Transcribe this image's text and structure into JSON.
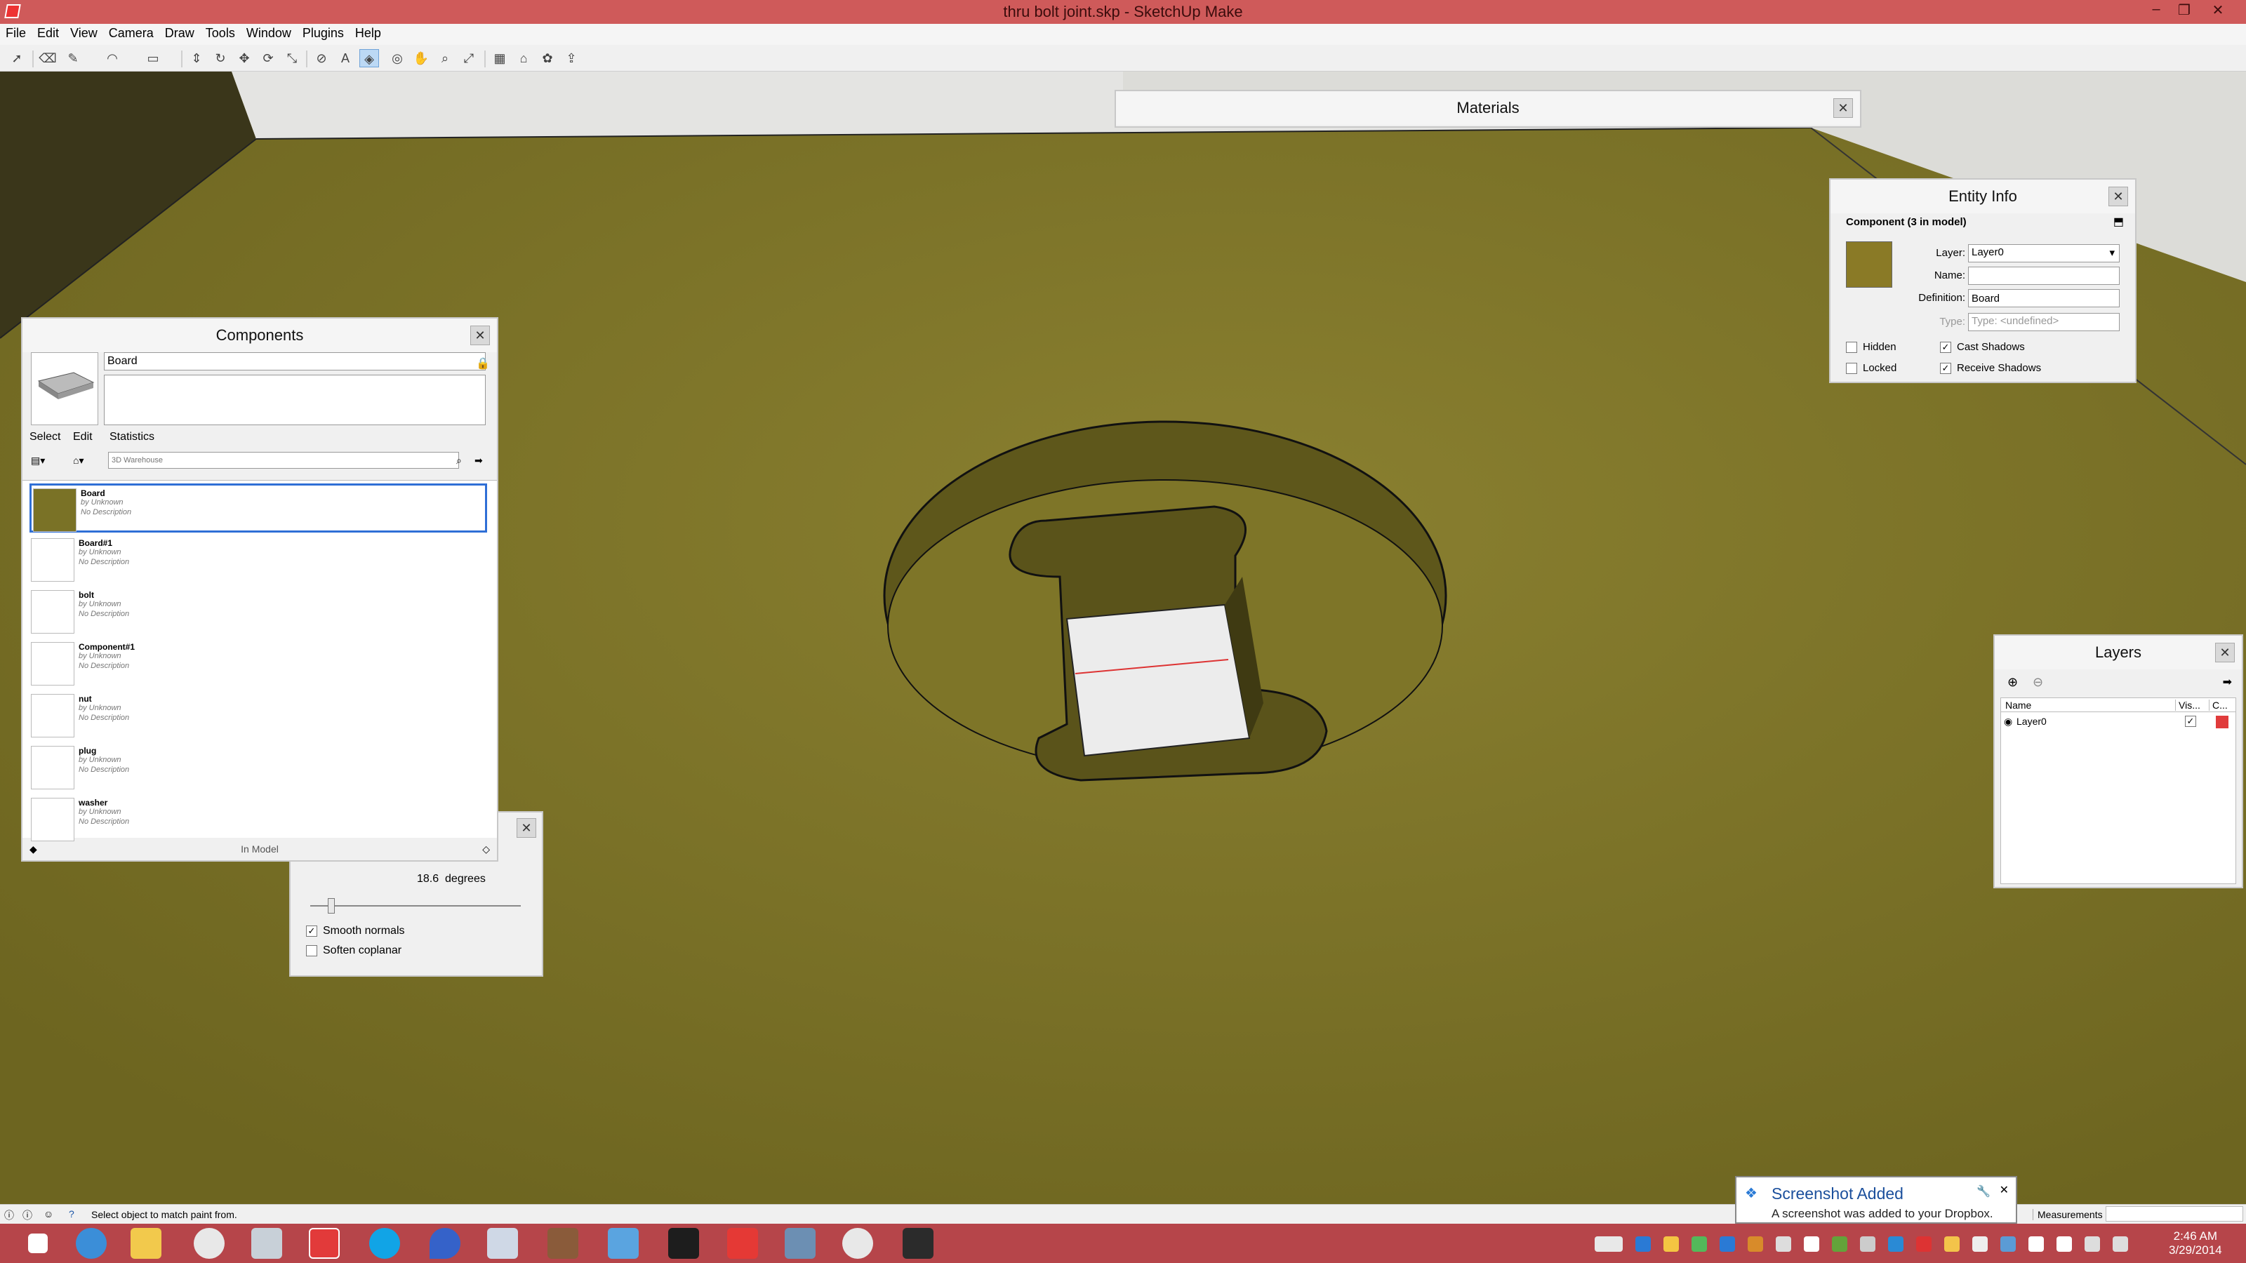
{
  "window": {
    "title": "thru bolt joint.skp - SketchUp Make",
    "minimize": "–",
    "maximize": "❐",
    "close": "✕"
  },
  "menu": [
    "File",
    "Edit",
    "View",
    "Camera",
    "Draw",
    "Tools",
    "Window",
    "Plugins",
    "Help"
  ],
  "toolbar": {
    "tools": [
      "select",
      "eraser",
      "pencil",
      "arc",
      "rectangle",
      "push-pull",
      "follow-me",
      "move",
      "rotate",
      "scale",
      "tape-measure",
      "text",
      "paint-bucket",
      "orbit",
      "pan",
      "zoom",
      "zoom-extents",
      "components",
      "warehouse",
      "extension",
      "share"
    ],
    "active_tool": "paint-bucket"
  },
  "materials_panel": {
    "title": "Materials",
    "close": "✕"
  },
  "entity_info": {
    "title": "Entity Info",
    "heading": "Component (3 in model)",
    "layer_label": "Layer:",
    "layer_value": "Layer0",
    "name_label": "Name:",
    "name_value": "",
    "definition_label": "Definition:",
    "definition_value": "Board",
    "type_label": "Type:",
    "type_value": "Type: <undefined>",
    "hidden_label": "Hidden",
    "locked_label": "Locked",
    "cast_shadows_label": "Cast Shadows",
    "receive_shadows_label": "Receive Shadows",
    "hidden": false,
    "locked": false,
    "cast_shadows": true,
    "receive_shadows": true
  },
  "components": {
    "title": "Components",
    "name_value": "Board",
    "tabs": [
      "Select",
      "Edit",
      "Statistics"
    ],
    "search_placeholder": "3D Warehouse",
    "footer": "In Model",
    "items": [
      {
        "name": "Board",
        "author": "by Unknown",
        "desc": "No Description",
        "selected": true
      },
      {
        "name": "Board#1",
        "author": "by Unknown",
        "desc": "No Description",
        "selected": false
      },
      {
        "name": "bolt",
        "author": "by Unknown",
        "desc": "No Description",
        "selected": false
      },
      {
        "name": "Component#1",
        "author": "by Unknown",
        "desc": "No Description",
        "selected": false
      },
      {
        "name": "nut",
        "author": "by Unknown",
        "desc": "No Description",
        "selected": false
      },
      {
        "name": "plug",
        "author": "by Unknown",
        "desc": "No Description",
        "selected": false
      },
      {
        "name": "washer",
        "author": "by Unknown",
        "desc": "No Description",
        "selected": false
      }
    ]
  },
  "soften_panel": {
    "angle_value": "18.6",
    "angle_unit": "degrees",
    "slider_fraction": 0.1,
    "smooth_normals_label": "Smooth normals",
    "soften_coplanar_label": "Soften coplanar",
    "smooth_normals": true,
    "soften_coplanar": false
  },
  "layers": {
    "title": "Layers",
    "col_name": "Name",
    "col_visible": "Vis...",
    "col_color": "C...",
    "rows": [
      {
        "name": "Layer0",
        "visible": true,
        "color": "#e03b3b"
      }
    ]
  },
  "status": {
    "message": "Select object to match paint from.",
    "measurements_label": "Measurements"
  },
  "toast": {
    "title": "Screenshot Added",
    "body": "A screenshot was added to your Dropbox."
  },
  "clock": {
    "time": "2:46 AM",
    "date": "3/29/2014"
  },
  "colors": {
    "wood": "#7a7226",
    "accent": "#cf5a5a",
    "taskbar": "#b6454a",
    "selection": "#2f6fd6"
  }
}
